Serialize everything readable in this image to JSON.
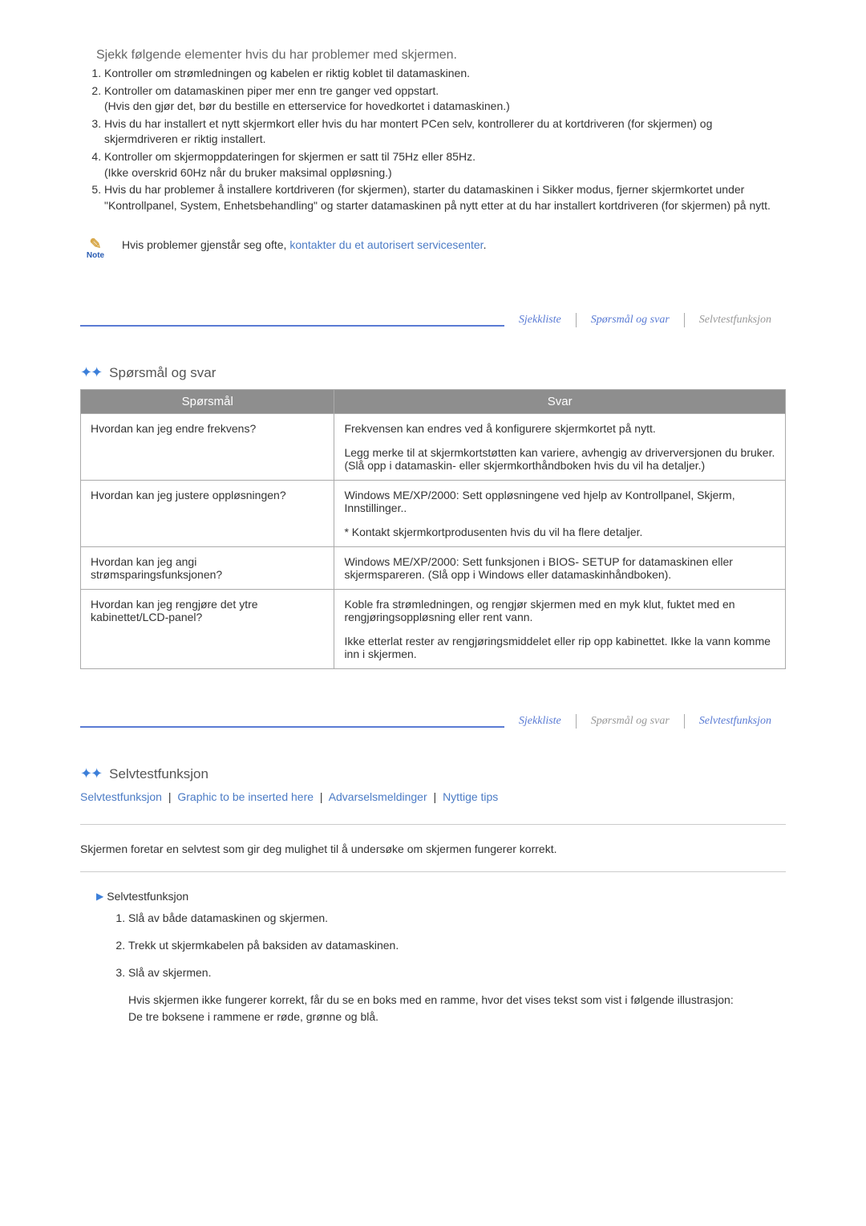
{
  "intro": {
    "heading": "Sjekk følgende elementer hvis du har problemer med skjermen.",
    "items": [
      {
        "text": "Kontroller om strømledningen og kabelen er riktig koblet til datamaskinen."
      },
      {
        "text": "Kontroller om datamaskinen piper mer enn tre ganger ved oppstart.",
        "sub": "(Hvis den gjør det, bør du bestille en etterservice for hovedkortet i datamaskinen.)"
      },
      {
        "text": "Hvis du har installert et nytt skjermkort eller hvis du har montert PCen selv, kontrollerer du at kortdriveren (for skjermen) og skjermdriveren er riktig installert."
      },
      {
        "text": "Kontroller om skjermoppdateringen for skjermen er satt til 75Hz eller 85Hz.",
        "sub": "(Ikke overskrid 60Hz når du bruker maksimal oppløsning.)"
      },
      {
        "text": "Hvis du har problemer å installere kortdriveren (for skjermen), starter du datamaskinen i Sikker modus, fjerner skjermkortet under \"Kontrollpanel, System, Enhetsbehandling\" og starter datamaskinen på nytt etter at du har installert kortdriveren (for skjermen) på nytt."
      }
    ]
  },
  "note": {
    "label": "Note",
    "text_prefix": "Hvis problemer gjenstår seg ofte, ",
    "link_text": "kontakter du et autorisert servicesenter",
    "text_suffix": "."
  },
  "tabs1": {
    "t1": "Sjekkliste",
    "t2": "Spørsmål og svar",
    "t3": "Selvtestfunksjon"
  },
  "qa": {
    "title": "Spørsmål og svar",
    "col_q": "Spørsmål",
    "col_a": "Svar",
    "rows": [
      {
        "q": "Hvordan kan jeg endre frekvens?",
        "a1": "Frekvensen kan endres ved å konfigurere skjermkortet på nytt.",
        "a2": "Legg merke til at skjermkortstøtten kan variere, avhengig av driverversjonen du bruker. (Slå opp i datamaskin- eller skjermkorthåndboken hvis du vil ha detaljer.)"
      },
      {
        "q": "Hvordan kan jeg justere oppløsningen?",
        "a1": "Windows ME/XP/2000: Sett oppløsningene ved hjelp av Kontrollpanel, Skjerm, Innstillinger..",
        "a2": "* Kontakt skjermkortprodusenten hvis du vil ha flere detaljer."
      },
      {
        "q": "Hvordan kan jeg angi strømsparingsfunksjonen?",
        "a1": "Windows ME/XP/2000: Sett funksjonen i BIOS- SETUP for datamaskinen eller skjermspareren. (Slå opp i Windows eller datamaskinhåndboken)."
      },
      {
        "q": "Hvordan kan jeg rengjøre det ytre kabinettet/LCD-panel?",
        "a1": "Koble fra strømledningen, og rengjør skjermen med en myk klut, fuktet med en rengjøringsoppløsning eller rent vann.",
        "a2": "Ikke etterlat rester av rengjøringsmiddelet eller rip opp kabinettet. Ikke la vann komme inn i skjermen."
      }
    ]
  },
  "tabs2": {
    "t1": "Sjekkliste",
    "t2": "Spørsmål og svar",
    "t3": "Selvtestfunksjon"
  },
  "selftest": {
    "title": "Selvtestfunksjon",
    "links": {
      "l1": "Selvtestfunksjon",
      "l2": "Graphic to be inserted here",
      "l3": "Advarselsmeldinger",
      "l4": "Nyttige tips"
    },
    "intro_text": "Skjermen foretar en selvtest som gir deg mulighet til å undersøke om skjermen fungerer korrekt.",
    "sub_title": "Selvtestfunksjon",
    "steps": [
      "Slå av både datamaskinen og skjermen.",
      "Trekk ut skjermkabelen på baksiden av datamaskinen.",
      "Slå av skjermen."
    ],
    "step_para1": "Hvis skjermen ikke fungerer korrekt, får du se en boks med en ramme, hvor det vises tekst som vist i følgende illustrasjon:",
    "step_para2": "De tre boksene i rammene er røde, grønne og blå."
  }
}
